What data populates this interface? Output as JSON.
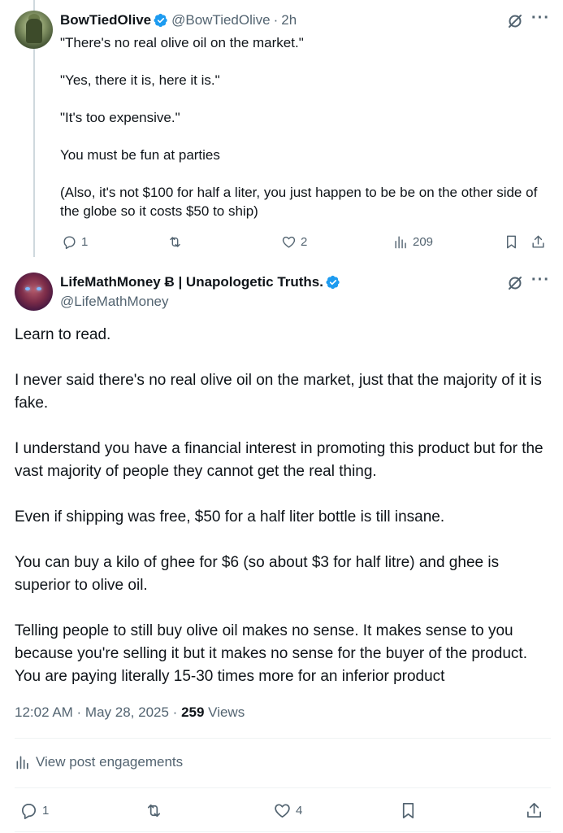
{
  "reply": {
    "author_name": "BowTiedOlive",
    "author_handle": "@BowTiedOlive",
    "separator": "·",
    "time_ago": "2h",
    "paragraphs": [
      "\"There's no real olive oil on the market.\"",
      "\"Yes, there it is, here it is.\"",
      "\"It's too expensive.\"",
      "You must be fun at parties",
      "(Also, it's not $100 for half a liter, you just happen to be be on the other side of the globe so it costs $50 to ship)"
    ],
    "actions": {
      "replies": "1",
      "retweets": "",
      "likes": "2",
      "views": "209"
    }
  },
  "main": {
    "author_name": "LifeMathMoney Ƀ | Unapologetic Truths.",
    "author_handle": "@LifeMathMoney",
    "paragraphs": [
      "Learn to read.",
      "I never said there's no real olive oil on the market, just that the majority of it is fake.",
      "I understand you have a financial interest in promoting this product but for the vast majority of people they cannot get the real thing.",
      "Even if shipping was free, $50 for a half liter bottle is till insane.",
      "You can buy a kilo of ghee for $6 (so about $3 for half litre) and ghee is superior to olive oil.",
      "Telling people to still buy olive oil makes no sense. It makes sense to you because you're selling it but it makes no sense for the buyer of the product. You are paying literally 15-30 times more for an inferior product"
    ],
    "timestamp": "12:02 AM · May 28, 2025 · ",
    "views_count": "259",
    "views_label": " Views",
    "engagements_label": "View post engagements",
    "actions": {
      "replies": "1",
      "retweets": "",
      "likes": "4"
    }
  },
  "icons": {
    "verified": "verified-badge-icon",
    "grok": "grok-icon",
    "more": "more-icon",
    "reply": "reply-icon",
    "retweet": "retweet-icon",
    "like": "heart-icon",
    "views": "views-icon",
    "bookmark": "bookmark-icon",
    "share": "share-icon"
  },
  "colors": {
    "verified": "#1d9bf0",
    "text": "#0f1419",
    "secondary": "#536471",
    "divider": "#eff3f4",
    "thread_line": "#cfd9de"
  }
}
